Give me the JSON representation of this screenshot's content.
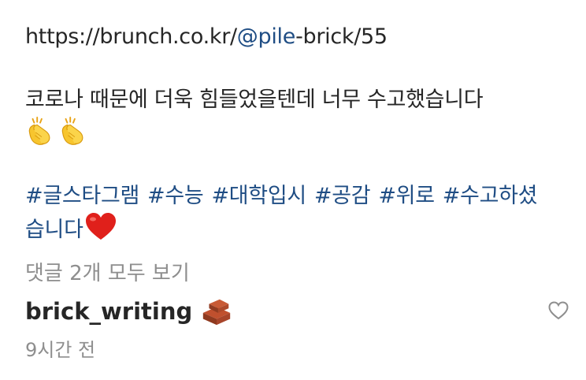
{
  "caption": {
    "link_prefix": "https://brunch.co.kr/",
    "link_mention": "@pile",
    "link_suffix": "-brick/55",
    "message": "코로나 때문에 더욱 힘들었을텐데 너무 수고했습니다",
    "emoji_icons": [
      "clapping-hands-icon",
      "clapping-hands-icon"
    ],
    "hashtags": [
      "#글스타그램",
      "#수능",
      "#대학입시",
      "#공감",
      "#위로",
      "#수고하셨"
    ],
    "hashtag_continuation": "습니다",
    "heart_icon": "red-heart-icon"
  },
  "view_comments_label": "댓글 2개 모두 보기",
  "comment": {
    "username": "brick_writing",
    "username_icon": "brick-icon",
    "like_icon": "heart-outline-icon",
    "time": "9시간 전"
  },
  "colors": {
    "text": "#262626",
    "link": "#1f4d84",
    "muted": "#8e8e8e",
    "heart": "#e0201b"
  }
}
